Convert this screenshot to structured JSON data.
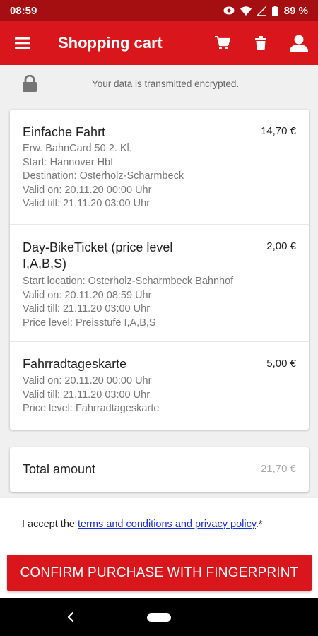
{
  "status_bar": {
    "time": "08:59",
    "battery": "89 %"
  },
  "header": {
    "title": "Shopping cart",
    "icons": [
      "menu-icon",
      "cart-icon",
      "trash-icon",
      "user-icon"
    ]
  },
  "security": {
    "message": "Your data is transmitted encrypted."
  },
  "cart": {
    "items": [
      {
        "title": "Einfache Fahrt",
        "price": "14,70 €",
        "lines": [
          "Erw. BahnCard 50 2. Kl.",
          "Start: Hannover Hbf",
          "Destination: Osterholz-Scharmbeck",
          "Valid on: 20.11.20 00:00 Uhr",
          "Valid till: 21.11.20 03:00 Uhr"
        ]
      },
      {
        "title": "Day-BikeTicket (price level I,A,B,S)",
        "price": "2,00 €",
        "lines": [
          "Start location: Osterholz-Scharmbeck Bahnhof",
          "Valid on: 20.11.20 08:59 Uhr",
          "Valid till: 21.11.20 03:00 Uhr",
          "Price level: Preisstufe I,A,B,S"
        ]
      },
      {
        "title": "Fahrradtageskarte",
        "price": "5,00 €",
        "lines": [
          "Valid on: 20.11.20 00:00 Uhr",
          "Valid till: 21.11.20 03:00 Uhr",
          "Price level: Fahrradtageskarte"
        ]
      }
    ]
  },
  "total": {
    "label": "Total amount",
    "value": "21,70 €"
  },
  "terms": {
    "prefix": "I accept the ",
    "link": "terms and conditions and privacy policy",
    "suffix": ".*"
  },
  "confirm_button": {
    "label": "CONFIRM PURCHASE WITH FINGERPRINT"
  },
  "colors": {
    "primary": "#d8161b",
    "status_bar": "#a50f12",
    "link": "#1a2fd6"
  }
}
